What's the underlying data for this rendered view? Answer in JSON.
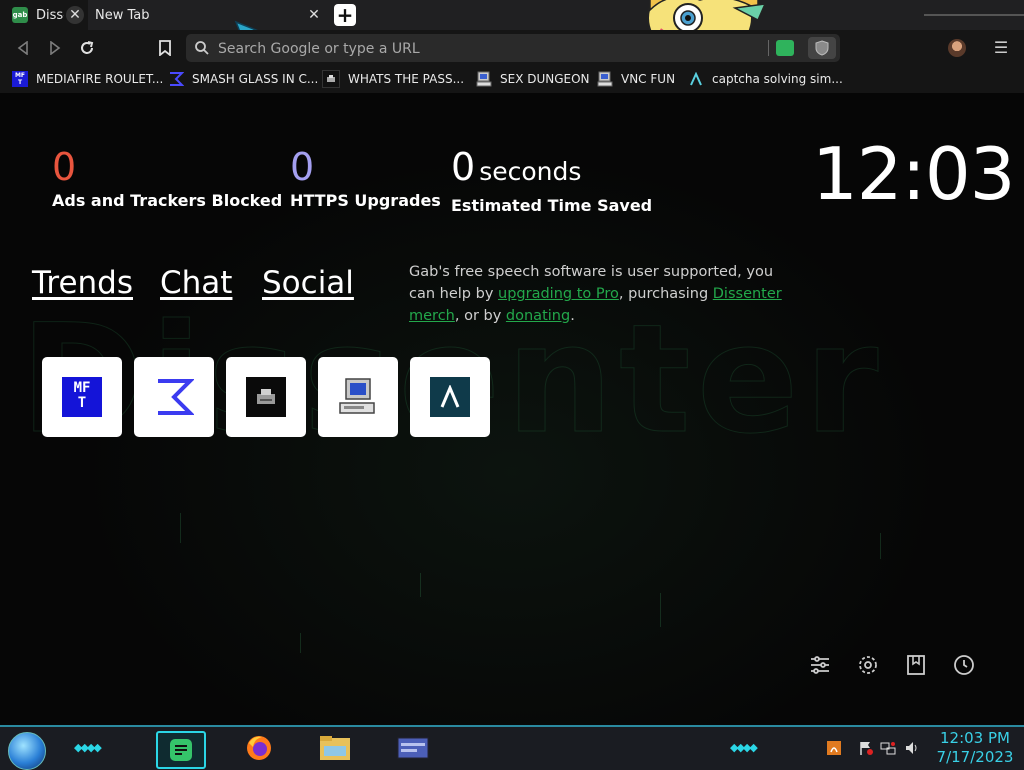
{
  "browser": {
    "tabs": [
      {
        "title": "Disse",
        "favicon_text": "gab",
        "active": true
      },
      {
        "title": "New Tab",
        "active": false
      }
    ],
    "new_tab_symbol": "+",
    "search": {
      "placeholder": "Search Google or type a URL",
      "value": ""
    },
    "menu_symbol": "☰"
  },
  "bookmarks": [
    {
      "label": "MEDIAFIRE ROULET...",
      "icon": "mft-icon"
    },
    {
      "label": "SMASH GLASS IN C...",
      "icon": "sigma-icon"
    },
    {
      "label": "WHATS THE PASS...",
      "icon": "printer-icon"
    },
    {
      "label": "SEX DUNGEON",
      "icon": "computer-icon"
    },
    {
      "label": "VNC FUN",
      "icon": "computer-icon"
    },
    {
      "label": "captcha solving sim...",
      "icon": "lambda-icon"
    }
  ],
  "stats": {
    "trackers": {
      "value": "0",
      "label": "Ads and Trackers Blocked",
      "color": "#e8553e"
    },
    "https": {
      "value": "0",
      "label": "HTTPS Upgrades",
      "color": "#a49ff0"
    },
    "time": {
      "value": "0",
      "unit": "seconds",
      "label": "Estimated Time Saved",
      "color": "#ffffff"
    }
  },
  "clock": "12:03",
  "nav_links": [
    "Trends",
    "Chat",
    "Social"
  ],
  "support": {
    "text1": "Gab's free speech software is user supported, you can help by ",
    "link1": "upgrading to Pro",
    "text2": ", purchasing ",
    "link2": "Dissenter merch",
    "text3": ", or by ",
    "link3": "donating",
    "text4": "."
  },
  "tiles": [
    "mft-icon",
    "sigma-icon",
    "printer-icon",
    "computer-icon",
    "lambda-icon"
  ],
  "bottom_icons": [
    "customize-icon",
    "settings-icon",
    "bookmarks-icon",
    "history-icon"
  ],
  "taskbar": {
    "time": "12:03 PM",
    "date": "7/17/2023",
    "apps": [
      "notes-app-icon",
      "firefox-icon",
      "file-explorer-icon",
      "window-app-icon"
    ]
  },
  "colors": {
    "accent_green": "#23a84b",
    "taskbar_cyan": "#2bd6e6"
  }
}
